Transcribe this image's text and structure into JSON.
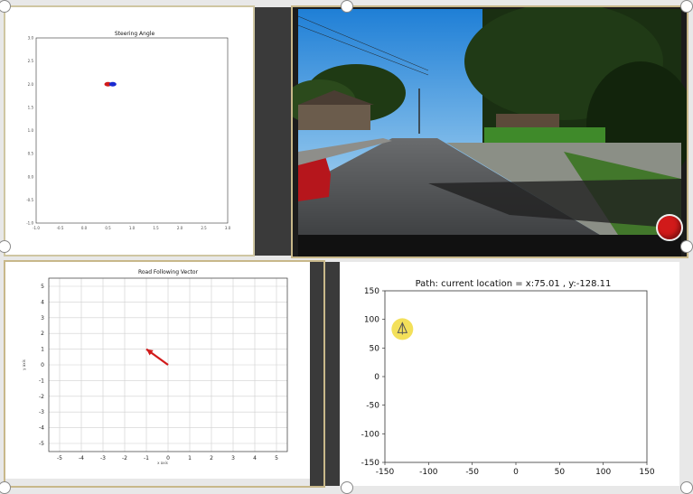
{
  "steering_plot": {
    "title": "Steering Angle",
    "yticks": [
      "3.0",
      "2.5",
      "2.0",
      "1.5",
      "1.0",
      "0.5",
      "0.0",
      "-0.5",
      "-1.0"
    ],
    "xticks": [
      "-1.0",
      "-0.5",
      "0.0",
      "0.5",
      "1.0",
      "1.5",
      "2.0",
      "2.5",
      "3.0"
    ],
    "chart_data": {
      "type": "scatter",
      "title": "Steering Angle",
      "xlim": [
        -1.0,
        3.0
      ],
      "ylim": [
        -1.0,
        3.0
      ],
      "series": [
        {
          "color": "#d11a1a",
          "points": [
            [
              0.5,
              2.0
            ]
          ]
        },
        {
          "color": "#1a2ad1",
          "points": [
            [
              0.6,
              2.0
            ]
          ]
        }
      ]
    }
  },
  "camera_view": {
    "record_button_color": "#d11a1a"
  },
  "road_vector_plot": {
    "title": "Road Following Vector",
    "xlabel": "x axis",
    "ylabel": "y axis",
    "yticks": [
      "5",
      "4",
      "3",
      "2",
      "1",
      "0",
      "-1",
      "-2",
      "-3",
      "-4",
      "-5"
    ],
    "xticks": [
      "-5",
      "-4",
      "-3",
      "-2",
      "-1",
      "0",
      "1",
      "2",
      "3",
      "4",
      "5"
    ],
    "chart_data": {
      "type": "vector",
      "title": "Road Following Vector",
      "xlim": [
        -5,
        5
      ],
      "ylim": [
        -5,
        5
      ],
      "arrow": {
        "start": [
          0,
          0
        ],
        "end": [
          -1,
          1
        ],
        "color": "#d11a1a"
      },
      "grid": true
    }
  },
  "path_plot": {
    "title": "Path: current location = x:75.01 , y:-128.11",
    "yticks": [
      "150",
      "100",
      "50",
      "0",
      "-50",
      "-100",
      "-150"
    ],
    "xticks": [
      "-150",
      "-100",
      "-50",
      "0",
      "50",
      "100",
      "150"
    ],
    "marker_icon": "tree-icon",
    "chart_data": {
      "type": "scatter",
      "title": "Path: current location = x:75.01 , y:-128.11",
      "xlim": [
        -150,
        150
      ],
      "ylim": [
        -150,
        150
      ],
      "current_location": {
        "x": 75.01,
        "y": -128.11
      },
      "marker": {
        "x": -130,
        "y": 83,
        "color": "#f3e05a"
      }
    }
  }
}
